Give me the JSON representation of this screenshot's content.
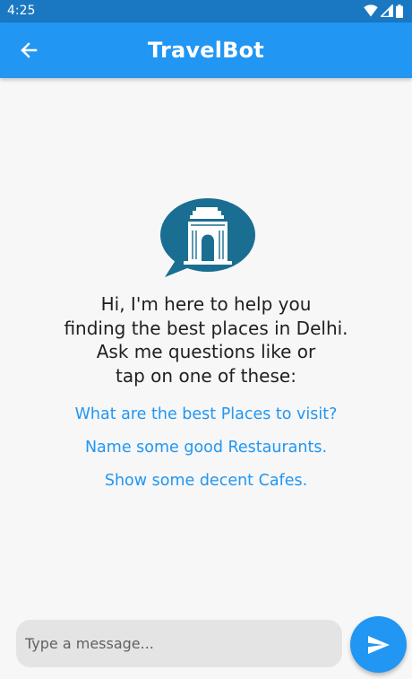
{
  "status_bar": {
    "time": "4:25",
    "icons": [
      "wifi-icon",
      "signal-icon",
      "battery-icon"
    ]
  },
  "app_bar": {
    "title": "TravelBot",
    "back_icon": "arrow-back-icon",
    "color": "#2196f3"
  },
  "hero": {
    "logo_icon": "india-gate-chat-bubble-icon",
    "logo_color": "#1a6e91",
    "intro_text": "Hi, I'm here to help you\nfinding the best places in Delhi.\nAsk me questions like or\ntap on one of these:"
  },
  "suggestions": [
    "What are the best Places to visit?",
    "Name some good Restaurants.",
    "Show some decent Cafes."
  ],
  "composer": {
    "placeholder": "Type a message...",
    "value": "",
    "send_icon": "send-icon"
  },
  "colors": {
    "accent": "#2196f3",
    "status_bar": "#1a78c2",
    "background": "#f7f7f7"
  }
}
